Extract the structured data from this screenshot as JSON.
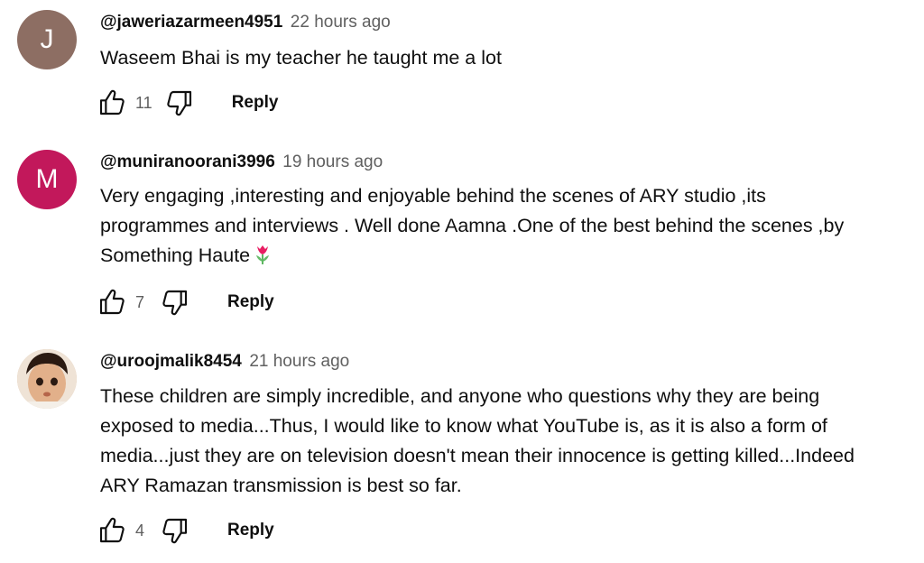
{
  "comments": [
    {
      "avatar_letter": "J",
      "avatar_color": "#8d6e63",
      "author": "@jaweriazarmeen4951",
      "time": "22 hours ago",
      "text": "Waseem Bhai is my teacher he taught me a lot",
      "likes": "11",
      "reply_label": "Reply"
    },
    {
      "avatar_letter": "M",
      "avatar_color": "#c2185b",
      "author": "@muniranoorani3996",
      "time": "19 hours ago",
      "text": "Very engaging ,interesting and enjoyable behind the scenes of ARY studio ,its\nprogrammes and interviews . Well done Aamna .One of the best behind the scenes ,by\nSomething Haute",
      "emoji": "tulip",
      "likes": "7",
      "reply_label": "Reply"
    },
    {
      "avatar_image": "child-photo",
      "author": "@uroojmalik8454",
      "time": "21 hours ago",
      "text": "These children are simply incredible, and anyone who questions why they are being\nexposed to media...Thus, I would like to know what YouTube is, as it is also a form of\nmedia...just they are on television doesn't mean their innocence is getting killed...Indeed\nARY Ramazan transmission is best so far.",
      "likes": "4",
      "reply_label": "Reply"
    }
  ]
}
